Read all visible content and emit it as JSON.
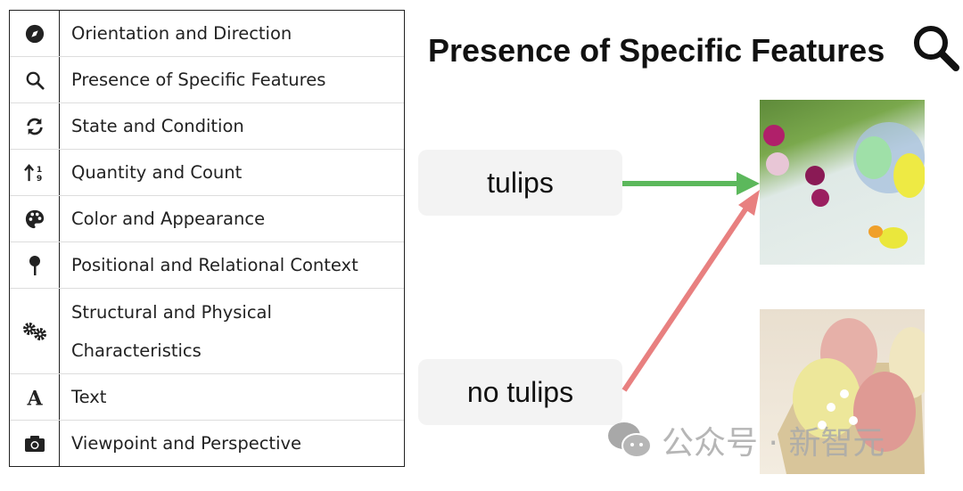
{
  "categories": [
    {
      "icon": "compass-icon",
      "label": "Orientation and Direction"
    },
    {
      "icon": "search-icon",
      "label": "Presence of Specific Features"
    },
    {
      "icon": "refresh-icon",
      "label": "State and Condition"
    },
    {
      "icon": "sort-numeric-icon",
      "label": "Quantity and Count"
    },
    {
      "icon": "palette-icon",
      "label": "Color and Appearance"
    },
    {
      "icon": "map-pin-icon",
      "label": "Positional and Relational Context"
    },
    {
      "icon": "cogs-icon",
      "label": "Structural and Physical Characteristics"
    },
    {
      "icon": "font-icon",
      "label": "Text"
    },
    {
      "icon": "camera-icon",
      "label": "Viewpoint and Perspective"
    }
  ],
  "example": {
    "title": "Presence of Specific Features",
    "title_icon": "search-icon",
    "prompts": [
      "tulips",
      "no tulips"
    ],
    "arrow_colors": {
      "positive": "#5cb85c",
      "negative": "#e88080"
    }
  },
  "watermark": "公众号 · 新智元"
}
